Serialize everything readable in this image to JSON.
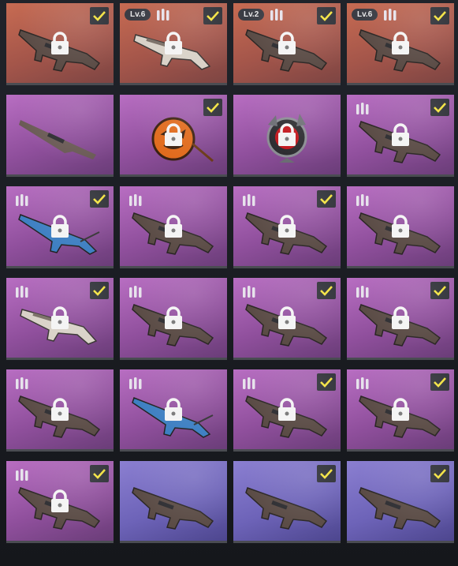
{
  "colors": {
    "check_accent": "#f2e13a",
    "lock_fill": "#f4f4f4",
    "orange_card": "#b45e4d",
    "purple_card": "#9a58a6",
    "blue_card": "#6f65b8"
  },
  "cards": [
    {
      "rarity": "orange",
      "icon": "assault-rifle-icon",
      "locked": true,
      "checked": true,
      "level": "",
      "ammo": false
    },
    {
      "rarity": "orange",
      "icon": "shotgun-icon",
      "locked": true,
      "checked": true,
      "level": "Lv.6",
      "ammo": true
    },
    {
      "rarity": "orange",
      "icon": "assault-rifle-icon",
      "locked": true,
      "checked": true,
      "level": "Lv.2",
      "ammo": true
    },
    {
      "rarity": "orange",
      "icon": "assault-rifle-icon",
      "locked": true,
      "checked": true,
      "level": "Lv.6",
      "ammo": true
    },
    {
      "rarity": "purple",
      "icon": "sniper-rifle-icon",
      "locked": false,
      "checked": false,
      "level": "",
      "ammo": false
    },
    {
      "rarity": "purple",
      "icon": "pumpkin-charm-icon",
      "locked": true,
      "checked": true,
      "level": "",
      "ammo": false
    },
    {
      "rarity": "purple",
      "icon": "emblem-icon",
      "locked": true,
      "checked": false,
      "level": "",
      "ammo": false
    },
    {
      "rarity": "purple",
      "icon": "assault-rifle-icon",
      "locked": true,
      "checked": true,
      "level": "",
      "ammo": true
    },
    {
      "rarity": "purple",
      "icon": "marksman-rifle-icon",
      "locked": true,
      "checked": true,
      "level": "",
      "ammo": true
    },
    {
      "rarity": "purple",
      "icon": "assault-rifle-icon",
      "locked": true,
      "checked": false,
      "level": "",
      "ammo": true
    },
    {
      "rarity": "purple",
      "icon": "assault-rifle-icon",
      "locked": true,
      "checked": true,
      "level": "",
      "ammo": true
    },
    {
      "rarity": "purple",
      "icon": "assault-rifle-icon",
      "locked": true,
      "checked": false,
      "level": "",
      "ammo": true
    },
    {
      "rarity": "purple",
      "icon": "shotgun-icon",
      "locked": true,
      "checked": true,
      "level": "",
      "ammo": true
    },
    {
      "rarity": "purple",
      "icon": "assault-rifle-icon",
      "locked": true,
      "checked": false,
      "level": "",
      "ammo": true
    },
    {
      "rarity": "purple",
      "icon": "assault-rifle-icon",
      "locked": true,
      "checked": true,
      "level": "",
      "ammo": true
    },
    {
      "rarity": "purple",
      "icon": "assault-rifle-icon",
      "locked": true,
      "checked": true,
      "level": "",
      "ammo": true
    },
    {
      "rarity": "purple",
      "icon": "assault-rifle-icon",
      "locked": true,
      "checked": false,
      "level": "",
      "ammo": true
    },
    {
      "rarity": "purple",
      "icon": "marksman-rifle-icon",
      "locked": true,
      "checked": false,
      "level": "",
      "ammo": true
    },
    {
      "rarity": "purple",
      "icon": "assault-rifle-icon",
      "locked": true,
      "checked": true,
      "level": "",
      "ammo": true
    },
    {
      "rarity": "purple",
      "icon": "assault-rifle-icon",
      "locked": true,
      "checked": true,
      "level": "",
      "ammo": true
    },
    {
      "rarity": "purple",
      "icon": "assault-rifle-icon",
      "locked": true,
      "checked": true,
      "level": "",
      "ammo": true
    },
    {
      "rarity": "blue",
      "icon": "assault-rifle-icon",
      "locked": false,
      "checked": false,
      "level": "",
      "ammo": false
    },
    {
      "rarity": "blue",
      "icon": "assault-rifle-icon",
      "locked": false,
      "checked": true,
      "level": "",
      "ammo": false
    },
    {
      "rarity": "blue",
      "icon": "assault-rifle-icon",
      "locked": false,
      "checked": true,
      "level": "",
      "ammo": false
    }
  ]
}
